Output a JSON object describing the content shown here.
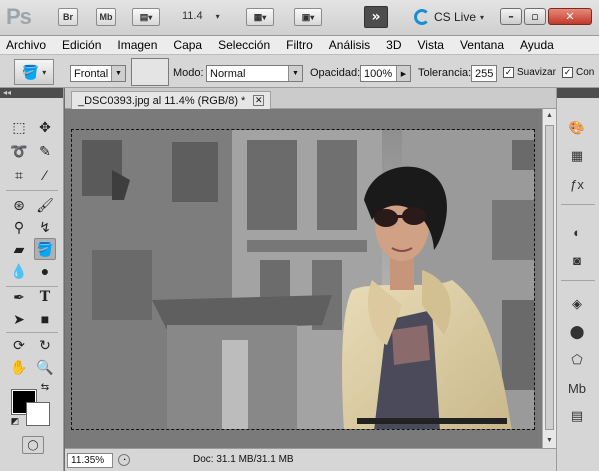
{
  "app": {
    "logo": "Ps",
    "bridge_btn": "Br",
    "minibridge_btn": "Mb",
    "zoom": "11.4",
    "workspace_btn": "»",
    "cslive": "CS Live"
  },
  "menu": [
    "Archivo",
    "Edición",
    "Imagen",
    "Capa",
    "Selección",
    "Filtro",
    "Análisis",
    "3D",
    "Vista",
    "Ventana",
    "Ayuda"
  ],
  "options": {
    "fill_source": "Frontal",
    "mode_label": "Modo:",
    "mode": "Normal",
    "opacity_label": "Opacidad:",
    "opacity": "100%",
    "tolerance_label": "Tolerancia:",
    "tolerance": "255",
    "antialias_label": "Suavizar",
    "contiguous_label": "Con"
  },
  "document": {
    "tab_title": "_DSC0393.jpg al 11.4% (RGB/8) *"
  },
  "status": {
    "zoom": "11.35%",
    "doc_info": "Doc: 31.1 MB/31.1 MB"
  },
  "colors": {
    "foreground": "#000000",
    "background": "#ffffff",
    "cs_accent": "#1a8fd0"
  }
}
